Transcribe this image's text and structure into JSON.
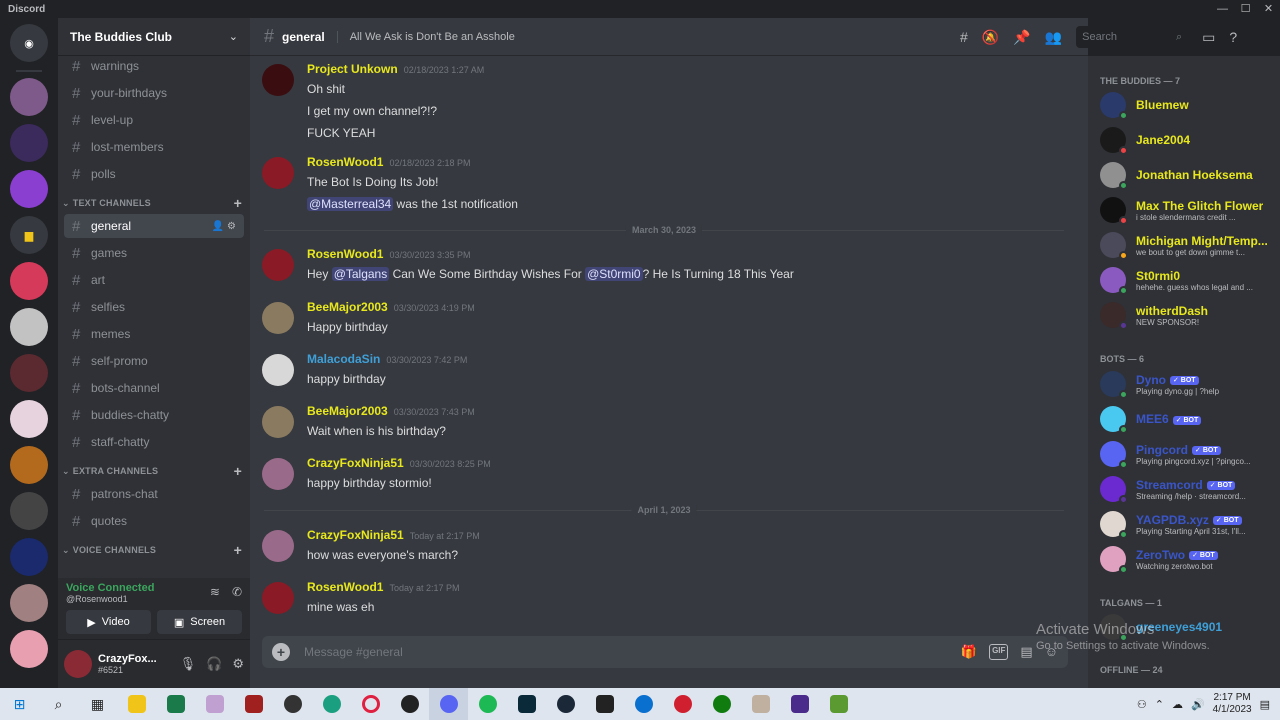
{
  "window": {
    "app_name": "Discord",
    "controls": [
      "—",
      "☐",
      "✕"
    ]
  },
  "server": {
    "name": "The Buddies Club"
  },
  "channels_top": [
    "warnings",
    "your-birthdays",
    "level-up",
    "lost-members",
    "polls"
  ],
  "text_category": "TEXT CHANNELS",
  "text_channels": [
    "general",
    "games",
    "art",
    "selfies",
    "memes",
    "self-promo",
    "bots-channel",
    "buddies-chatty",
    "staff-chatty"
  ],
  "extra_category": "EXTRA CHANNELS",
  "extra_channels": [
    "patrons-chat",
    "quotes"
  ],
  "voice_category": "VOICE CHANNELS",
  "voice": {
    "status": "Voice Connected",
    "sub": "@Rosenwood1",
    "video": "Video",
    "screen": "Screen"
  },
  "user": {
    "name": "CrazyFox...",
    "tag": "#6521"
  },
  "header": {
    "channel": "general",
    "topic": "All We Ask is Don't Be an Asshole",
    "search_placeholder": "Search"
  },
  "messages": [
    {
      "author": "Project Unkown",
      "color": "#e8e81c",
      "ts": "02/18/2023 1:27 AM",
      "lines": [
        "Oh shit",
        "I get my own channel?!?",
        "FUCK YEAH"
      ]
    },
    {
      "author": "RosenWood1",
      "color": "#e8e81c",
      "ts": "02/18/2023 2:18 PM",
      "lines": [
        "The Bot Is Doing Its Job!"
      ],
      "line2_mention": "@Masterreal34",
      "line2_rest": " was the 1st notification"
    },
    {
      "author": "RosenWood1",
      "color": "#e8e81c",
      "ts": "03/30/2023 3:35 PM",
      "p1": "Hey ",
      "m1": "@Talgans",
      "p2": " Can We Some Birthday Wishes For ",
      "m2": "@St0rmi0",
      "p3": "? He Is Turning 18 This Year"
    },
    {
      "author": "BeeMajor2003",
      "color": "#e8e81c",
      "ts": "03/30/2023 4:19 PM",
      "lines": [
        "Happy birthday"
      ]
    },
    {
      "author": "MalacodaSin",
      "color": "#3fa0d8",
      "ts": "03/30/2023 7:42 PM",
      "lines": [
        "happy birthday"
      ]
    },
    {
      "author": "BeeMajor2003",
      "color": "#e8e81c",
      "ts": "03/30/2023 7:43 PM",
      "lines": [
        "Wait when is his birthday?"
      ]
    },
    {
      "author": "CrazyFoxNinja51",
      "color": "#e8e81c",
      "ts": "03/30/2023 8:25 PM",
      "lines": [
        "happy birthday stormio!"
      ]
    },
    {
      "author": "CrazyFoxNinja51",
      "color": "#e8e81c",
      "ts": "Today at 2:17 PM",
      "lines": [
        "how was everyone's march?"
      ]
    },
    {
      "author": "RosenWood1",
      "color": "#e8e81c",
      "ts": "Today at 2:17 PM",
      "lines": [
        "mine was eh"
      ]
    }
  ],
  "dividers": [
    "March 30, 2023",
    "April 1, 2023"
  ],
  "composer_placeholder": "Message #general",
  "members": {
    "buddies_cat": "THE BUDDIES — 7",
    "buddies": [
      {
        "name": "Bluemew",
        "status": ""
      },
      {
        "name": "Jane2004",
        "status": ""
      },
      {
        "name": "Jonathan Hoeksema",
        "status": ""
      },
      {
        "name": "Max The Glitch Flower",
        "status": "i stole slendermans credit ..."
      },
      {
        "name": "Michigan Might/Temp...",
        "status": "we bout to get down gimme t..."
      },
      {
        "name": "St0rmi0",
        "status": "hehehe. guess whos legal and ..."
      },
      {
        "name": "witherdDash",
        "status": "NEW SPONSOR!"
      }
    ],
    "bots_cat": "BOTS — 6",
    "bots": [
      {
        "name": "Dyno",
        "status": "Playing dyno.gg | ?help"
      },
      {
        "name": "MEE6",
        "status": ""
      },
      {
        "name": "Pingcord",
        "status": "Playing pingcord.xyz | ?pingco..."
      },
      {
        "name": "Streamcord",
        "status": "Streaming /help · streamcord..."
      },
      {
        "name": "YAGPDB.xyz",
        "status": "Playing Starting April 31st, I'll..."
      },
      {
        "name": "ZeroTwo",
        "status": "Watching zerotwo.bot"
      }
    ],
    "bot_badge": "✓ BOT",
    "talgans_cat": "TALGANS — 1",
    "talgans": [
      {
        "name": "greeneyes4901"
      }
    ],
    "offline_cat": "OFFLINE — 24"
  },
  "watermark": {
    "line1": "Activate Windows",
    "line2": "Go to Settings to activate Windows."
  },
  "clock": {
    "time": "2:17 PM",
    "date": "4/1/2023"
  }
}
